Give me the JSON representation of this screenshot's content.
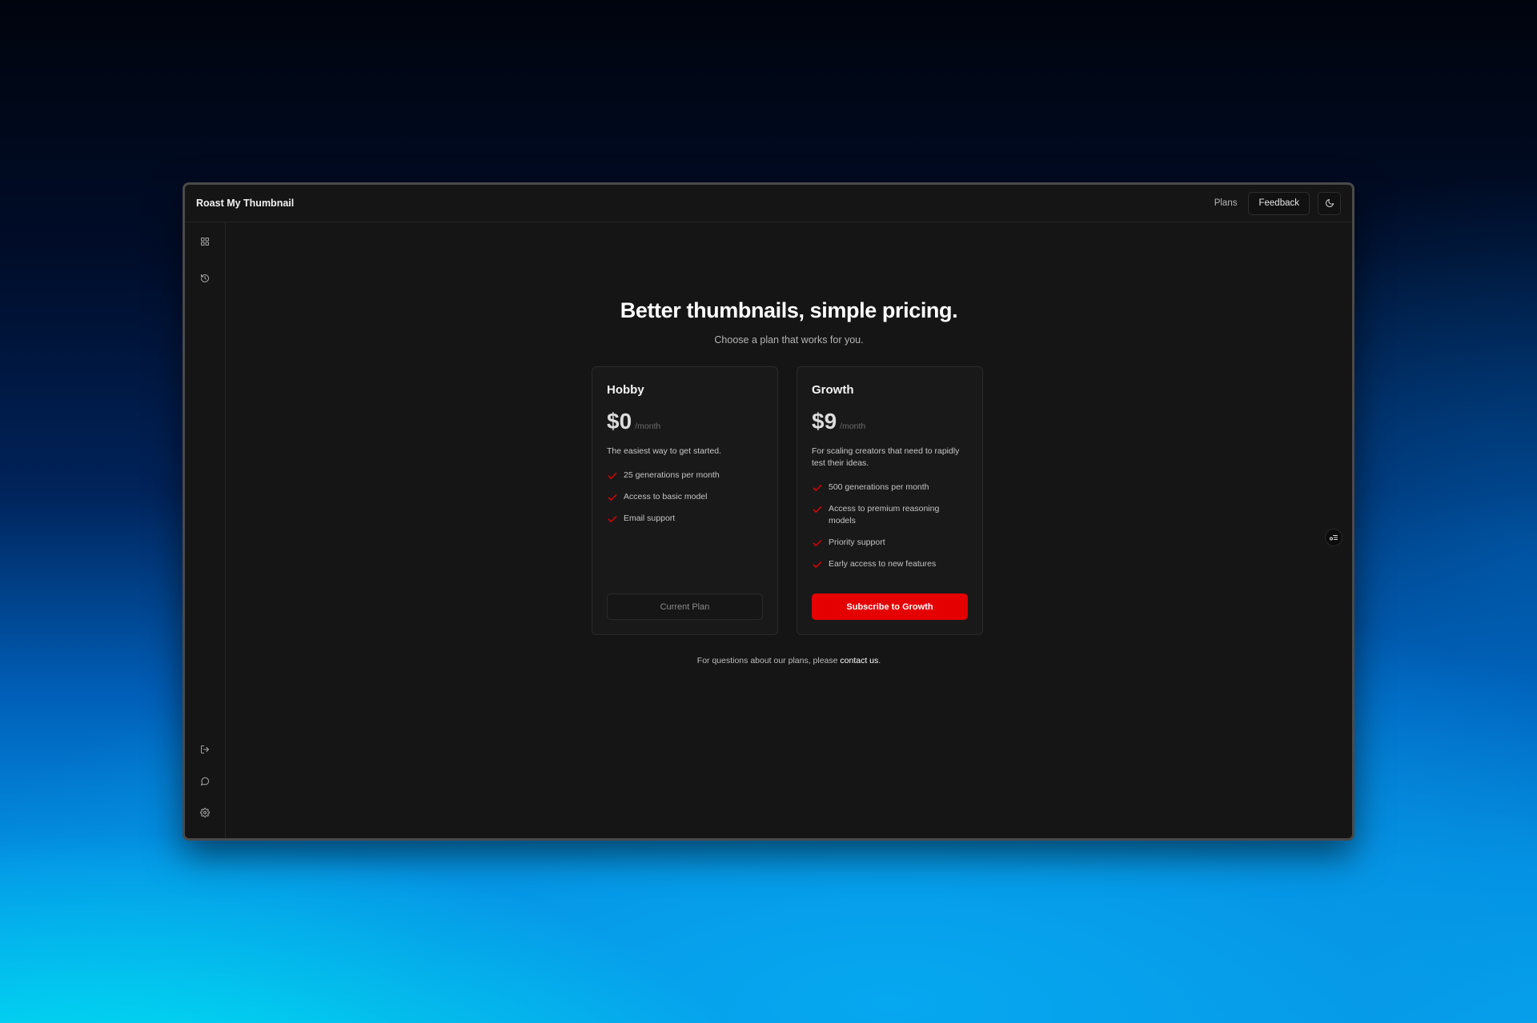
{
  "app": {
    "title": "Roast My Thumbnail"
  },
  "header": {
    "plans_label": "Plans",
    "feedback_label": "Feedback",
    "theme_icon": "moon-icon"
  },
  "sidebar": {
    "top_items": [
      {
        "icon": "grid-icon"
      },
      {
        "icon": "history-icon"
      }
    ],
    "bottom_items": [
      {
        "icon": "logout-icon"
      },
      {
        "icon": "message-icon"
      },
      {
        "icon": "gear-icon"
      }
    ]
  },
  "pricing": {
    "headline": "Better thumbnails, simple pricing.",
    "subheadline": "Choose a plan that works for you.",
    "plans": [
      {
        "name": "Hobby",
        "price": "$0",
        "period": "/month",
        "description": "The easiest way to get started.",
        "features": [
          "25 generations per month",
          "Access to basic model",
          "Email support"
        ],
        "button_label": "Current Plan"
      },
      {
        "name": "Growth",
        "price": "$9",
        "period": "/month",
        "description": "For scaling creators that need to rapidly test their ideas.",
        "features": [
          "500 generations per month",
          "Access to premium reasoning models",
          "Priority support",
          "Early access to new features"
        ],
        "button_label": "Subscribe to Growth"
      }
    ],
    "footer_prefix": "For questions about our plans, please ",
    "footer_link": "contact us",
    "footer_suffix": "."
  },
  "colors": {
    "accent": "#e50000",
    "window_bg": "#151515",
    "card_bg": "#191919"
  }
}
